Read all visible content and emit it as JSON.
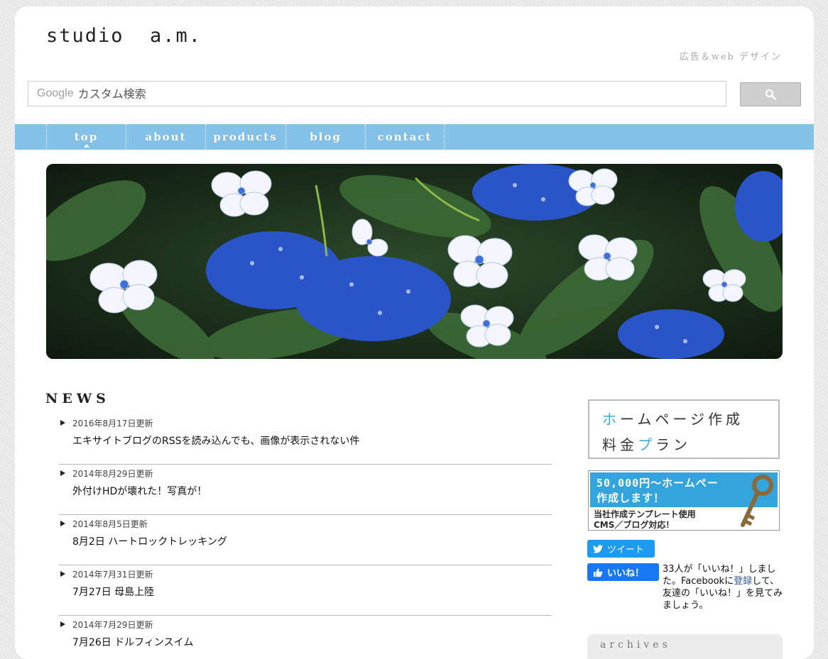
{
  "header": {
    "logo": "studio  a.m.",
    "tagline": "広告＆web デザイン"
  },
  "search": {
    "brand": "Google",
    "placeholder": "カスタム検索",
    "button_icon": "search-icon"
  },
  "nav": {
    "items": [
      {
        "label": "top",
        "active": true
      },
      {
        "label": "about"
      },
      {
        "label": "products"
      },
      {
        "label": "blog"
      },
      {
        "label": "contact"
      }
    ]
  },
  "news": {
    "title": "NEWS",
    "items": [
      {
        "date": "2016年8月17日更新",
        "title": "エキサイトブログのRSSを読み込んでも、画像が表示されない件"
      },
      {
        "date": "2014年8月29日更新",
        "title": "外付けHDが壊れた！写真が！"
      },
      {
        "date": "2014年8月5日更新",
        "title": "8月2日 ハートロックトレッキング"
      },
      {
        "date": "2014年7月31日更新",
        "title": "7月27日 母島上陸"
      },
      {
        "date": "2014年7月29日更新",
        "title": "7月26日 ドルフィンスイム"
      }
    ]
  },
  "sidebar": {
    "banner1": {
      "line1_accent": "ホ",
      "line1_rest": "ームページ作成",
      "line2_a": "料金",
      "line2_accent": "プ",
      "line2_b": "ラン"
    },
    "banner2": {
      "line1": "50,000円～ホームペー",
      "line2": "作成します！",
      "line3": "当社作成テンプレート使用",
      "line4": "CMS／ブログ対応！"
    },
    "tweet_label": "ツイート",
    "like_label": "いいね！",
    "like_text_1": "33人が「いいね！」しました。Facebookに",
    "like_link": "登録",
    "like_text_2": "して、友達の「いいね！」を見てみましょう。",
    "box_title": "archives"
  },
  "colors": {
    "nav_bg": "#84c1e9",
    "accent_blue": "#33a4dc",
    "tweet": "#1d9bf0",
    "facebook": "#1877f2"
  }
}
